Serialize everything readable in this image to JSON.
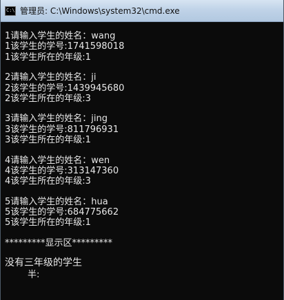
{
  "window": {
    "title": "管理员: C:\\Windows\\system32\\cmd.exe",
    "icon_text": "C:\\"
  },
  "console": {
    "blocks": [
      [
        "1请输入学生的姓名：wang",
        "1该学生的学号:1741598018",
        "1该学生所在的年级:1"
      ],
      [
        "2请输入学生的姓名：ji",
        "2该学生的学号:1439945680",
        "2该学生所在的年级:3"
      ],
      [
        "3请输入学生的姓名：jing",
        "3该学生的学号:811796931",
        "3该学生所在的年级:1"
      ],
      [
        "4请输入学生的姓名：wen",
        "4该学生的学号:313147360",
        "4该学生所在的年级:3"
      ],
      [
        "5请输入学生的姓名：hua",
        "5该学生的学号:684775662",
        "5该学生所在的年级:1"
      ]
    ],
    "display_header": "*********显示区*********",
    "result_line": "没有三年级的学生",
    "cursor_line": "        半:"
  }
}
